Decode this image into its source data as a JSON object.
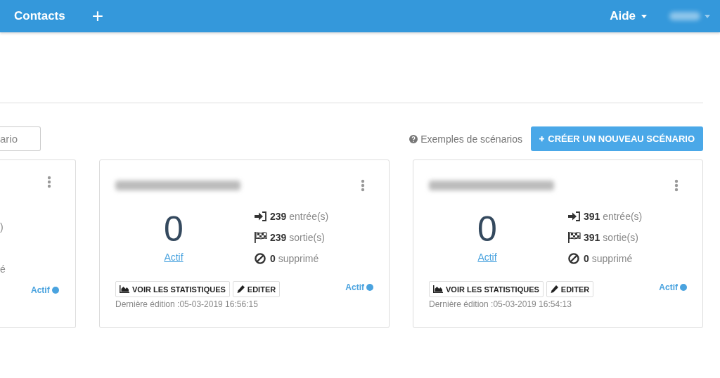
{
  "header": {
    "title": "Contacts",
    "add": "+",
    "help": "Aide"
  },
  "toolbar": {
    "search": {
      "placeholder": "ario"
    },
    "examples_link": "Exemples de scénarios",
    "create_button": "CRÉER UN NOUVEAU SCÉNARIO"
  },
  "cards": [
    {
      "kind": "partial",
      "stats": [
        {
          "kind": "entries",
          "label": ")"
        },
        {
          "kind": "deleted",
          "label": "é"
        }
      ],
      "status": "Actif",
      "active": true
    },
    {
      "kind": "full",
      "count": "0",
      "count_link": "Actif",
      "stats": [
        {
          "kind": "entries",
          "value": "239",
          "label": "entrée(s)"
        },
        {
          "kind": "exits",
          "value": "239",
          "label": "sortie(s)"
        },
        {
          "kind": "deleted",
          "value": "0",
          "label": "supprimé"
        }
      ],
      "buttons": [
        {
          "kind": "stats",
          "label": "VOIR LES STATISTIQUES"
        },
        {
          "kind": "edit",
          "label": "EDITER"
        }
      ],
      "last_edit": "Dernière édition :05-03-2019 16:56:15",
      "status": "Actif",
      "active": true
    },
    {
      "kind": "full",
      "count": "0",
      "count_link": "Actif",
      "stats": [
        {
          "kind": "entries",
          "value": "391",
          "label": "entrée(s)"
        },
        {
          "kind": "exits",
          "value": "391",
          "label": "sortie(s)"
        },
        {
          "kind": "deleted",
          "value": "0",
          "label": "supprimé"
        }
      ],
      "buttons": [
        {
          "kind": "stats",
          "label": "VOIR LES STATISTIQUES"
        },
        {
          "kind": "edit",
          "label": "EDITER"
        }
      ],
      "last_edit": "Dernière édition :05-03-2019 16:54:13",
      "status": "Actif",
      "active": true
    }
  ]
}
